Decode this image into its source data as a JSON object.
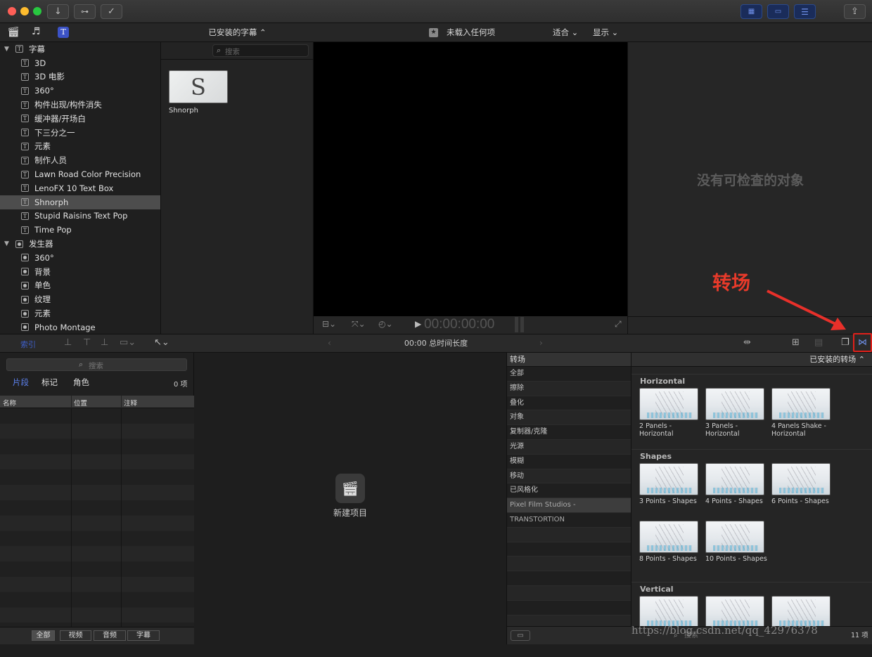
{
  "toolbar_top": {
    "window_controls": [
      "close",
      "minimize",
      "zoom"
    ],
    "import_icon": "download-arrow-icon",
    "keywords_icon": "key-icon",
    "bg_tasks_icon": "checkmark-circle-icon",
    "share_icon": "share-icon"
  },
  "browser": {
    "title": "已安装的字幕 ⌃",
    "search_placeholder": "搜索",
    "item_name": "Shnorph",
    "thumb_text": "S"
  },
  "sidebar": {
    "captions_header": "字幕",
    "captions": [
      "3D",
      "3D 电影",
      "360°",
      "构件出现/构件消失",
      "缓冲器/开场白",
      "下三分之一",
      "元素",
      "制作人员",
      "Lawn Road Color Precision",
      "LenoFX 10 Text Box",
      "Shnorph",
      "Stupid Raisins Text Pop",
      "Time Pop"
    ],
    "selected": "Shnorph",
    "generators_header": "发生器",
    "generators": [
      "360°",
      "背景",
      "单色",
      "纹理",
      "元素",
      "Photo Montage"
    ]
  },
  "viewer": {
    "status": "未载入任何项",
    "fit": "适合 ⌄",
    "display": "显示 ⌄",
    "timecode": "00:00:00:00"
  },
  "inspector": {
    "empty_text": "没有可检查的对象"
  },
  "annotation": {
    "label": "转场",
    "color": "#e83a2a"
  },
  "timeline_bar": {
    "index_label": "索引",
    "duration": "00:00 总时间长度"
  },
  "index": {
    "search_placeholder": "搜索",
    "tabs": [
      "片段",
      "标记",
      "角色"
    ],
    "count": "0 项",
    "columns": [
      "名称",
      "位置",
      "注释"
    ],
    "filters": [
      "全部",
      "视频",
      "音频",
      "字幕"
    ]
  },
  "timeline": {
    "new_project": "新建项目"
  },
  "transitions": {
    "header": "转场",
    "installed": "已安装的转场 ⌃",
    "categories": [
      "全部",
      "擦除",
      "叠化",
      "对象",
      "复制器/克隆",
      "光源",
      "模糊",
      "移动",
      "已风格化",
      "Pixel Film Studios - TRANSTORTION"
    ],
    "selected_category": "Pixel Film Studios - TRANSTORTION",
    "groups": [
      {
        "name": "Horizontal",
        "items": [
          "2 Panels - Horizontal",
          "3 Panels - Horizontal",
          "4 Panels Shake - Horizontal"
        ]
      },
      {
        "name": "Shapes",
        "items": [
          "3 Points - Shapes",
          "4 Points - Shapes",
          "6 Points - Shapes",
          "8 Points - Shapes",
          "10 Points - Shapes"
        ]
      },
      {
        "name": "Vertical",
        "items": [
          "",
          "",
          ""
        ]
      }
    ],
    "footer_count": "11 项",
    "search_placeholder": "搜索"
  },
  "watermark": "https://blog.csdn.net/qq_42976378",
  "colors": {
    "accent_blue": "#6f8fe8",
    "highlight_red": "#e0201a",
    "panel_bg": "#1e1e1e"
  }
}
